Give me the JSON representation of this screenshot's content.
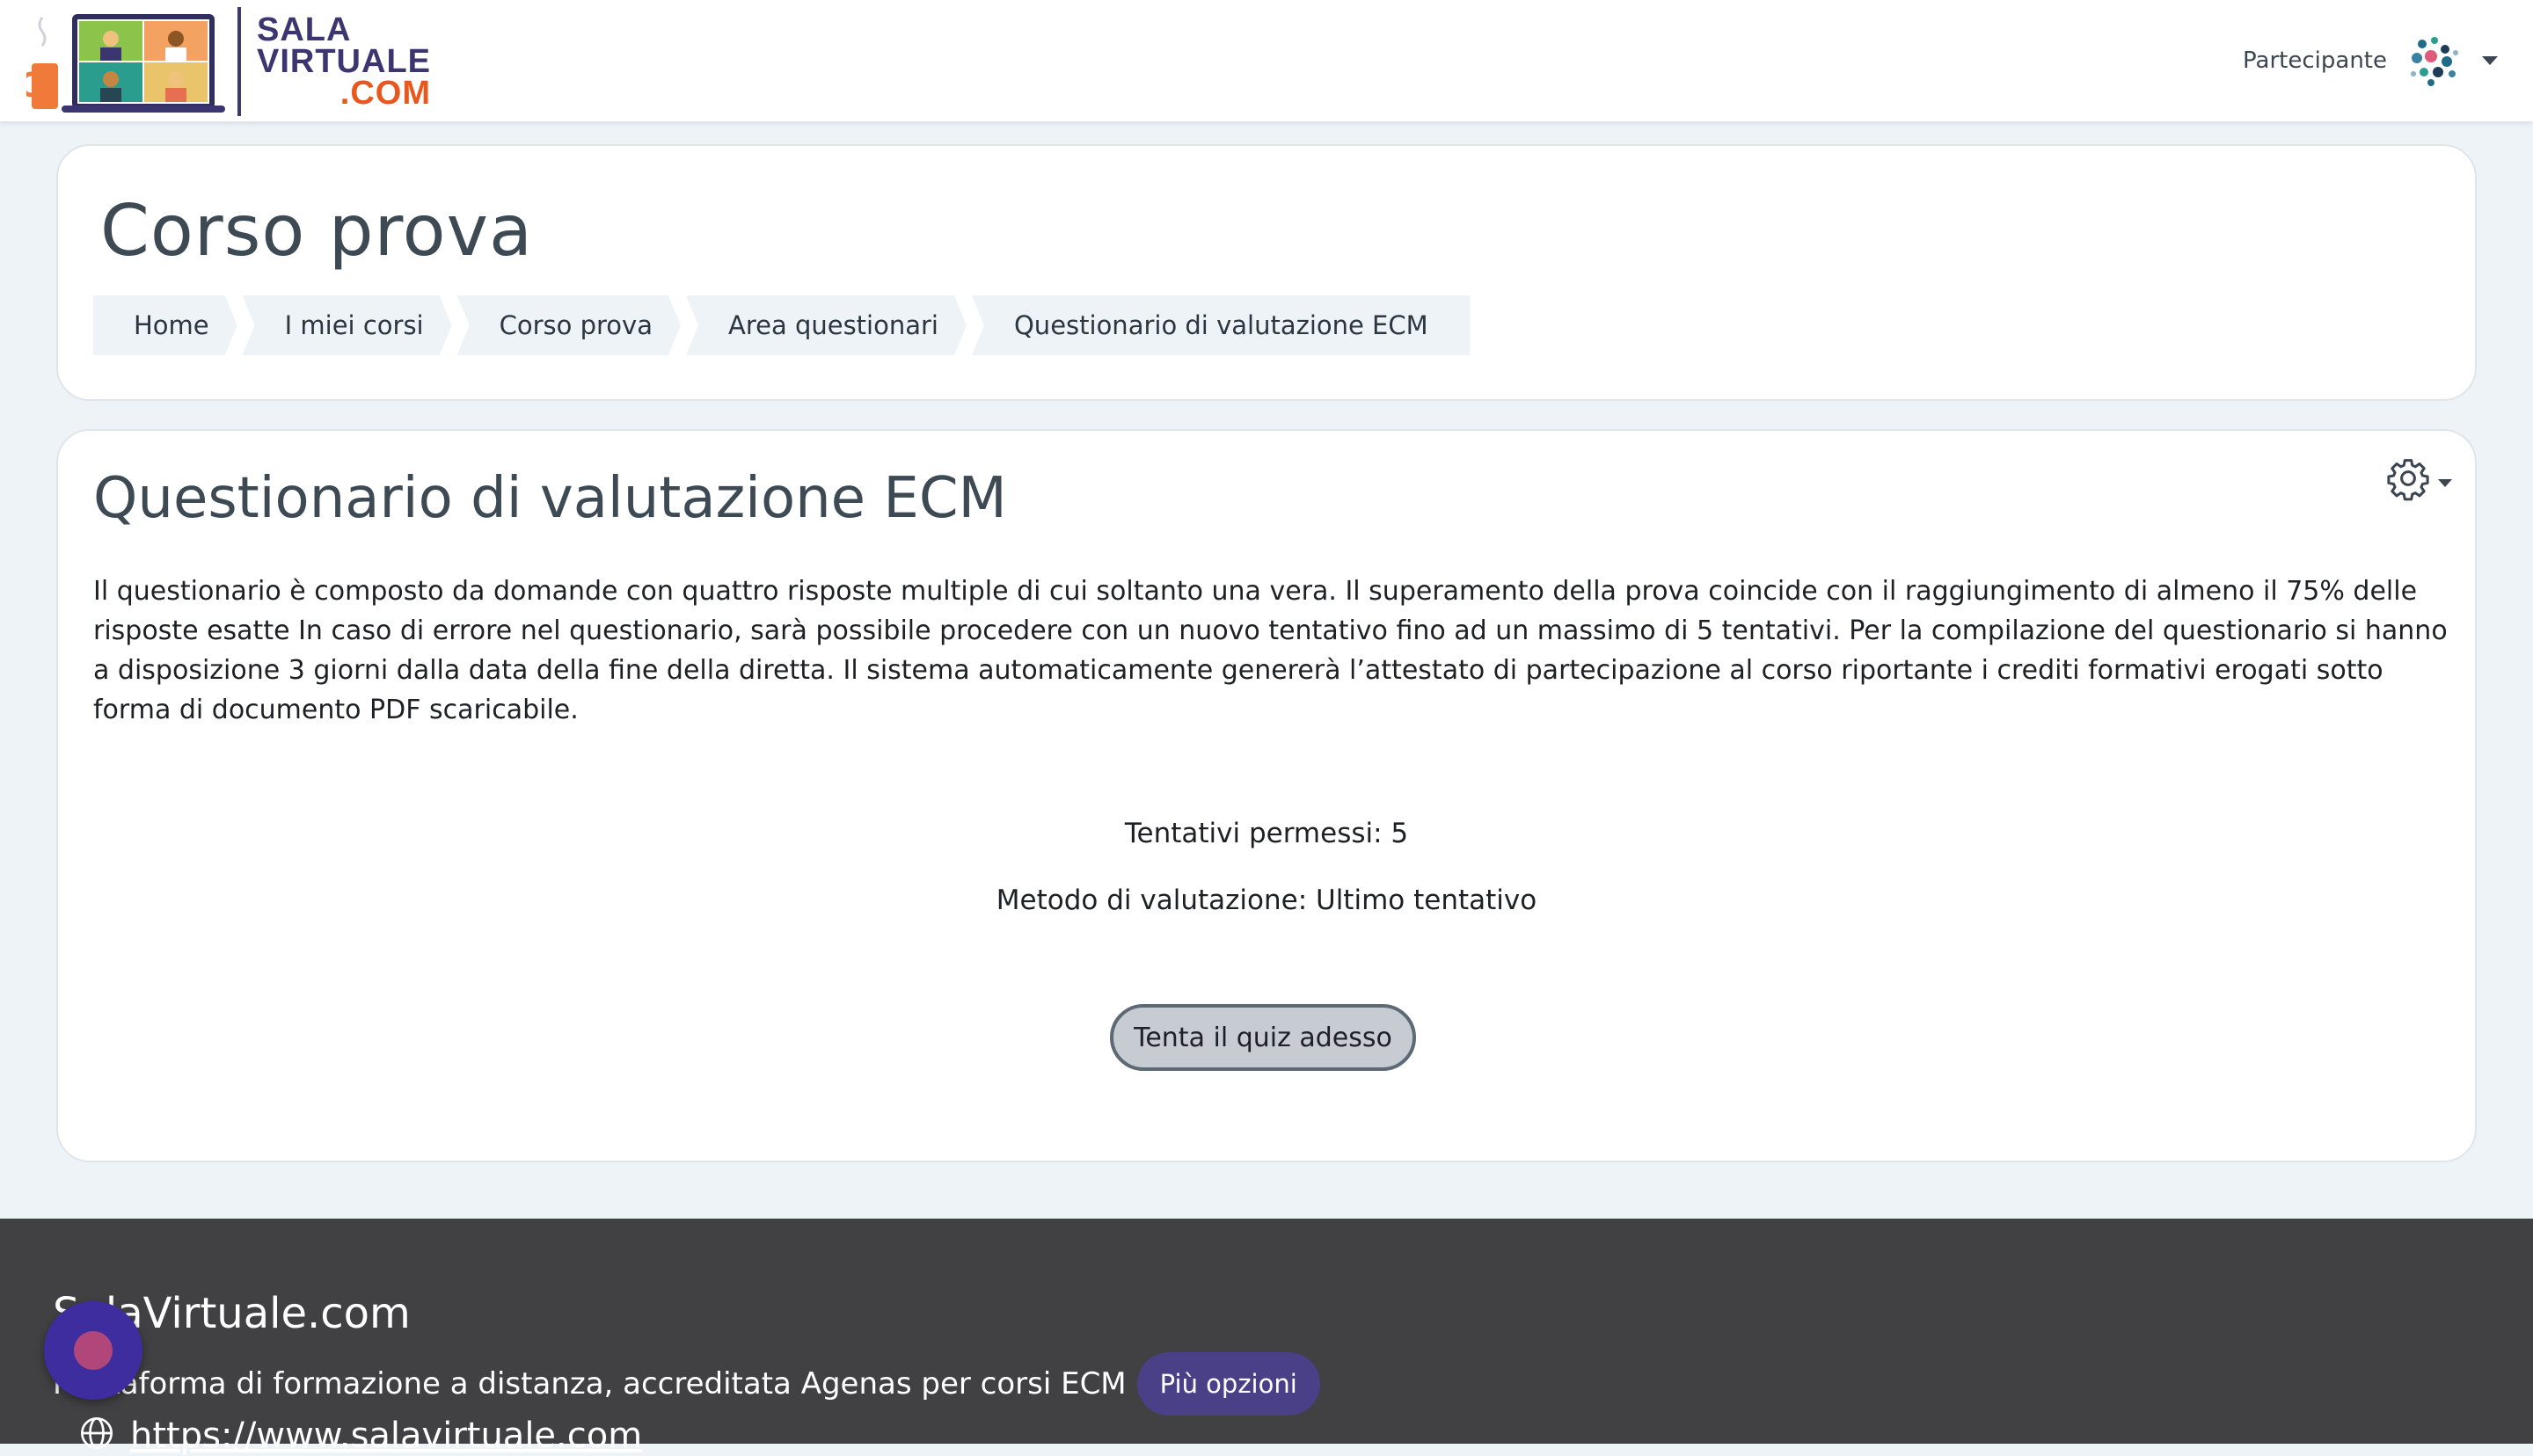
{
  "header": {
    "logo": {
      "line1": "SALA",
      "line2": "VIRTUALE",
      "line3": ".COM"
    },
    "user": {
      "name": "Partecipante"
    }
  },
  "course": {
    "title": "Corso prova",
    "breadcrumb": [
      "Home",
      "I miei corsi",
      "Corso prova",
      "Area questionari",
      "Questionario di valutazione ECM"
    ]
  },
  "quiz": {
    "title": "Questionario di valutazione ECM",
    "intro": "Il questionario è composto da domande con quattro risposte multiple di cui soltanto una vera. Il superamento della prova coincide con il raggiungimento di almeno il 75% delle risposte esatte In caso di errore nel questionario, sarà possibile procedere con un nuovo tentativo fino ad un massimo di 5 tentativi. Per la compilazione del questionario si hanno a disposizione 3 giorni dalla data della fine della diretta. Il sistema automaticamente genererà l’attestato di partecipazione al corso riportante i crediti formativi erogati sotto forma di documento PDF scaricabile.",
    "attempts_allowed": "Tentativi permessi: 5",
    "grading_method": "Metodo di valutazione: Ultimo tentativo",
    "attempt_button": "Tenta il quiz adesso"
  },
  "footer": {
    "title": "SalaVirtuale.com",
    "description": "Piattaforma di formazione a distanza, accreditata Agenas per corsi ECM",
    "more_button": "Più opzioni",
    "url": "https://www.salavirtuale.com"
  },
  "colors": {
    "brand_dark": "#3b3670",
    "brand_orange": "#e8581e",
    "footer_bg": "#414042",
    "accent_button": "#4a4087",
    "fab": "#3d2d9e"
  },
  "icons": [
    "gear-icon",
    "globe-icon",
    "user-avatar",
    "chat-fab-icon"
  ]
}
